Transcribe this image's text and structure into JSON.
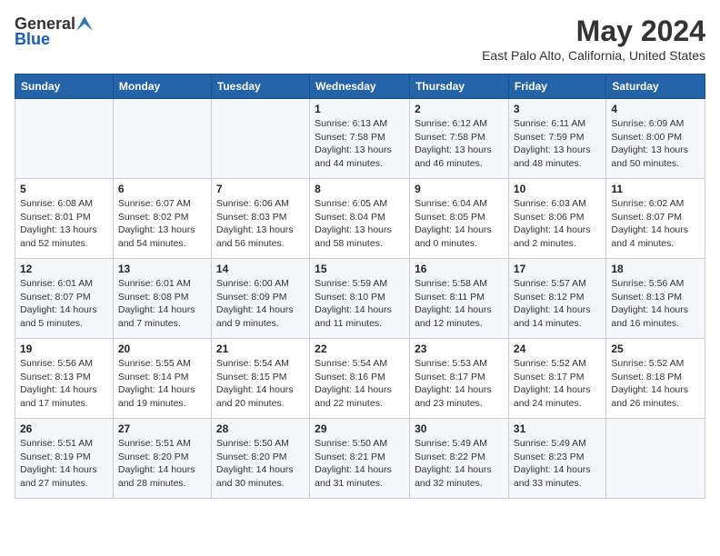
{
  "header": {
    "logo_general": "General",
    "logo_blue": "Blue",
    "month": "May 2024",
    "location": "East Palo Alto, California, United States"
  },
  "weekdays": [
    "Sunday",
    "Monday",
    "Tuesday",
    "Wednesday",
    "Thursday",
    "Friday",
    "Saturday"
  ],
  "weeks": [
    [
      {
        "day": "",
        "info": ""
      },
      {
        "day": "",
        "info": ""
      },
      {
        "day": "",
        "info": ""
      },
      {
        "day": "1",
        "info": "Sunrise: 6:13 AM\nSunset: 7:58 PM\nDaylight: 13 hours\nand 44 minutes."
      },
      {
        "day": "2",
        "info": "Sunrise: 6:12 AM\nSunset: 7:58 PM\nDaylight: 13 hours\nand 46 minutes."
      },
      {
        "day": "3",
        "info": "Sunrise: 6:11 AM\nSunset: 7:59 PM\nDaylight: 13 hours\nand 48 minutes."
      },
      {
        "day": "4",
        "info": "Sunrise: 6:09 AM\nSunset: 8:00 PM\nDaylight: 13 hours\nand 50 minutes."
      }
    ],
    [
      {
        "day": "5",
        "info": "Sunrise: 6:08 AM\nSunset: 8:01 PM\nDaylight: 13 hours\nand 52 minutes."
      },
      {
        "day": "6",
        "info": "Sunrise: 6:07 AM\nSunset: 8:02 PM\nDaylight: 13 hours\nand 54 minutes."
      },
      {
        "day": "7",
        "info": "Sunrise: 6:06 AM\nSunset: 8:03 PM\nDaylight: 13 hours\nand 56 minutes."
      },
      {
        "day": "8",
        "info": "Sunrise: 6:05 AM\nSunset: 8:04 PM\nDaylight: 13 hours\nand 58 minutes."
      },
      {
        "day": "9",
        "info": "Sunrise: 6:04 AM\nSunset: 8:05 PM\nDaylight: 14 hours\nand 0 minutes."
      },
      {
        "day": "10",
        "info": "Sunrise: 6:03 AM\nSunset: 8:06 PM\nDaylight: 14 hours\nand 2 minutes."
      },
      {
        "day": "11",
        "info": "Sunrise: 6:02 AM\nSunset: 8:07 PM\nDaylight: 14 hours\nand 4 minutes."
      }
    ],
    [
      {
        "day": "12",
        "info": "Sunrise: 6:01 AM\nSunset: 8:07 PM\nDaylight: 14 hours\nand 5 minutes."
      },
      {
        "day": "13",
        "info": "Sunrise: 6:01 AM\nSunset: 8:08 PM\nDaylight: 14 hours\nand 7 minutes."
      },
      {
        "day": "14",
        "info": "Sunrise: 6:00 AM\nSunset: 8:09 PM\nDaylight: 14 hours\nand 9 minutes."
      },
      {
        "day": "15",
        "info": "Sunrise: 5:59 AM\nSunset: 8:10 PM\nDaylight: 14 hours\nand 11 minutes."
      },
      {
        "day": "16",
        "info": "Sunrise: 5:58 AM\nSunset: 8:11 PM\nDaylight: 14 hours\nand 12 minutes."
      },
      {
        "day": "17",
        "info": "Sunrise: 5:57 AM\nSunset: 8:12 PM\nDaylight: 14 hours\nand 14 minutes."
      },
      {
        "day": "18",
        "info": "Sunrise: 5:56 AM\nSunset: 8:13 PM\nDaylight: 14 hours\nand 16 minutes."
      }
    ],
    [
      {
        "day": "19",
        "info": "Sunrise: 5:56 AM\nSunset: 8:13 PM\nDaylight: 14 hours\nand 17 minutes."
      },
      {
        "day": "20",
        "info": "Sunrise: 5:55 AM\nSunset: 8:14 PM\nDaylight: 14 hours\nand 19 minutes."
      },
      {
        "day": "21",
        "info": "Sunrise: 5:54 AM\nSunset: 8:15 PM\nDaylight: 14 hours\nand 20 minutes."
      },
      {
        "day": "22",
        "info": "Sunrise: 5:54 AM\nSunset: 8:16 PM\nDaylight: 14 hours\nand 22 minutes."
      },
      {
        "day": "23",
        "info": "Sunrise: 5:53 AM\nSunset: 8:17 PM\nDaylight: 14 hours\nand 23 minutes."
      },
      {
        "day": "24",
        "info": "Sunrise: 5:52 AM\nSunset: 8:17 PM\nDaylight: 14 hours\nand 24 minutes."
      },
      {
        "day": "25",
        "info": "Sunrise: 5:52 AM\nSunset: 8:18 PM\nDaylight: 14 hours\nand 26 minutes."
      }
    ],
    [
      {
        "day": "26",
        "info": "Sunrise: 5:51 AM\nSunset: 8:19 PM\nDaylight: 14 hours\nand 27 minutes."
      },
      {
        "day": "27",
        "info": "Sunrise: 5:51 AM\nSunset: 8:20 PM\nDaylight: 14 hours\nand 28 minutes."
      },
      {
        "day": "28",
        "info": "Sunrise: 5:50 AM\nSunset: 8:20 PM\nDaylight: 14 hours\nand 30 minutes."
      },
      {
        "day": "29",
        "info": "Sunrise: 5:50 AM\nSunset: 8:21 PM\nDaylight: 14 hours\nand 31 minutes."
      },
      {
        "day": "30",
        "info": "Sunrise: 5:49 AM\nSunset: 8:22 PM\nDaylight: 14 hours\nand 32 minutes."
      },
      {
        "day": "31",
        "info": "Sunrise: 5:49 AM\nSunset: 8:23 PM\nDaylight: 14 hours\nand 33 minutes."
      },
      {
        "day": "",
        "info": ""
      }
    ]
  ]
}
